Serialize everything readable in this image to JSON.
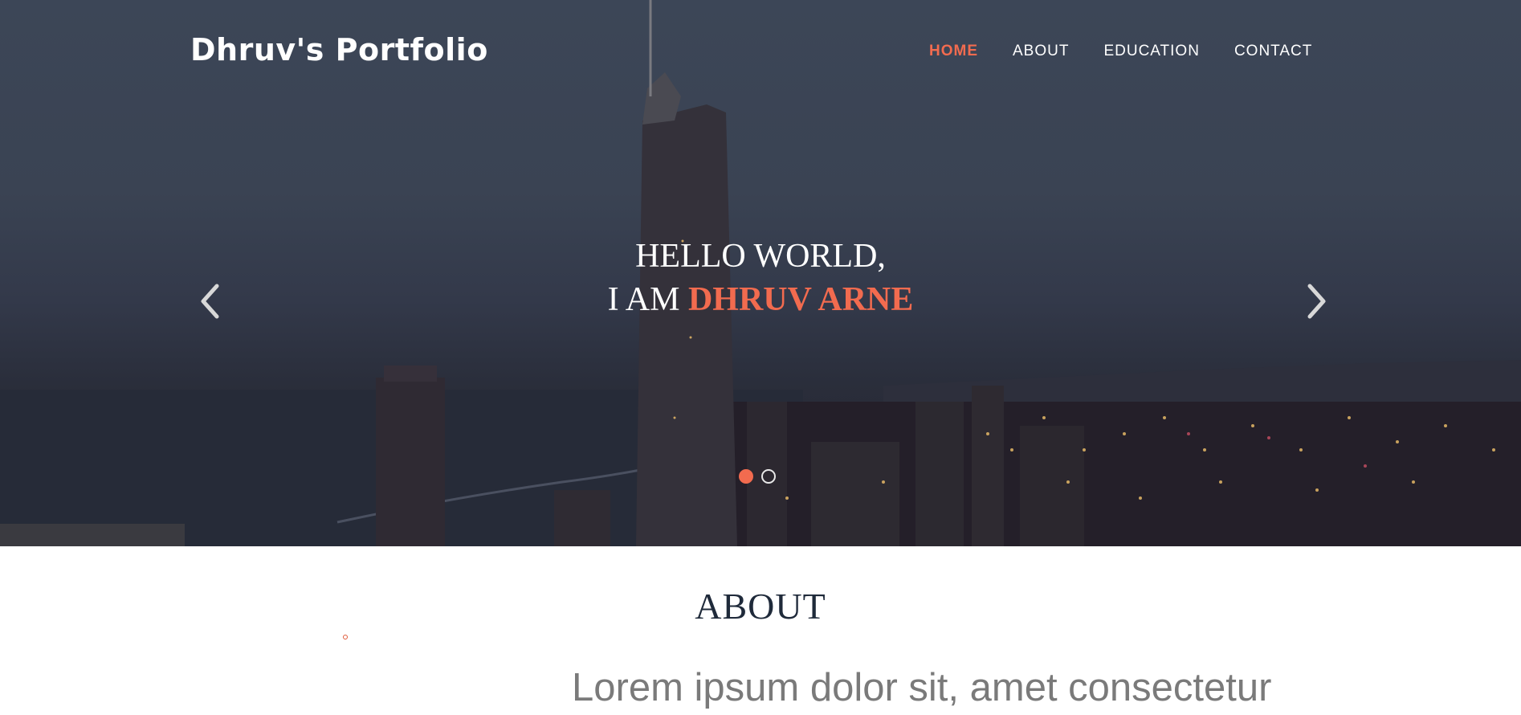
{
  "brand": "Dhruv's Portfolio",
  "nav": {
    "items": [
      {
        "label": "HOME",
        "active": true
      },
      {
        "label": "ABOUT",
        "active": false
      },
      {
        "label": "EDUCATION",
        "active": false
      },
      {
        "label": "CONTACT",
        "active": false
      }
    ]
  },
  "hero": {
    "line1": "HELLO WORLD,",
    "line2_prefix": "I AM ",
    "line2_name": "DHRUV ARNE",
    "prev_icon": "chevron-left-icon",
    "next_icon": "chevron-right-icon",
    "slides": 2,
    "active_slide": 1
  },
  "about": {
    "title": "ABOUT",
    "text": "Lorem ipsum dolor sit, amet consectetur"
  },
  "colors": {
    "accent": "#f26b4f",
    "heading": "#1f2a3a",
    "body_text": "#7a7a7a"
  }
}
